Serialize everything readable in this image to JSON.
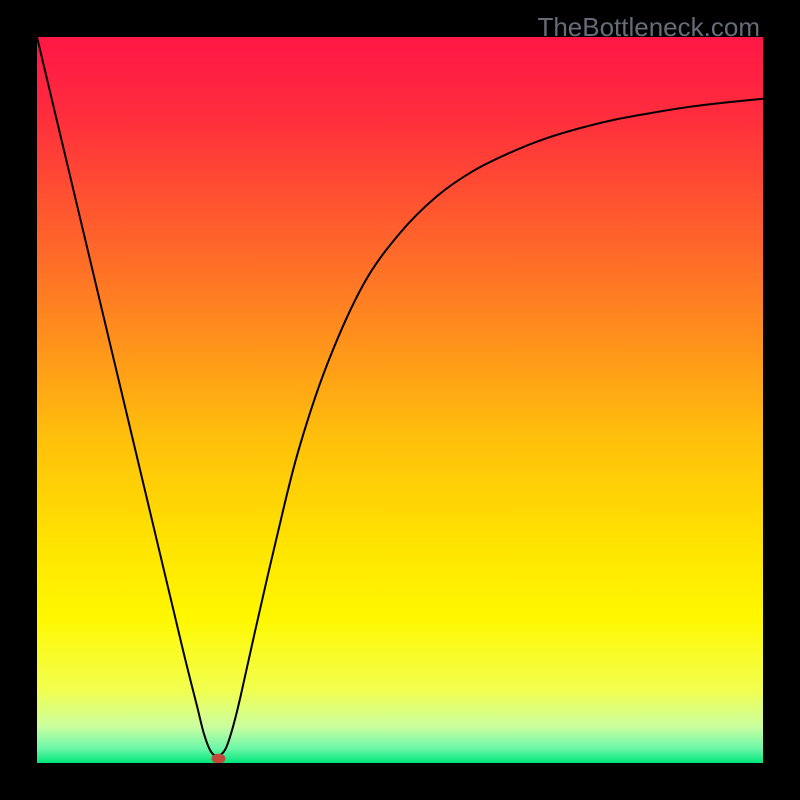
{
  "watermark": "TheBottleneck.com",
  "chart_data": {
    "type": "line",
    "title": "",
    "xlabel": "",
    "ylabel": "",
    "xlim": [
      0,
      100
    ],
    "ylim": [
      0,
      100
    ],
    "grid": false,
    "background": {
      "gradient_stops": [
        {
          "offset": 0.0,
          "color": "#ff1746"
        },
        {
          "offset": 0.1,
          "color": "#ff2b3e"
        },
        {
          "offset": 0.25,
          "color": "#ff5a2e"
        },
        {
          "offset": 0.4,
          "color": "#ff8b1e"
        },
        {
          "offset": 0.55,
          "color": "#ffbf0c"
        },
        {
          "offset": 0.7,
          "color": "#ffe400"
        },
        {
          "offset": 0.8,
          "color": "#fff800"
        },
        {
          "offset": 0.9,
          "color": "#f2ff50"
        },
        {
          "offset": 0.95,
          "color": "#caffa0"
        },
        {
          "offset": 0.98,
          "color": "#6cf7a8"
        },
        {
          "offset": 1.0,
          "color": "#00e67a"
        }
      ]
    },
    "series": [
      {
        "name": "bottleneck-curve",
        "color": "#000000",
        "stroke_width": 2,
        "x": [
          0,
          5,
          10,
          15,
          20,
          22,
          23,
          24,
          25,
          26,
          27,
          28,
          30,
          33,
          36,
          40,
          45,
          50,
          55,
          60,
          65,
          70,
          75,
          80,
          85,
          90,
          95,
          100
        ],
        "values": [
          100,
          79,
          58,
          37,
          16,
          8,
          4,
          1.5,
          1,
          2,
          5,
          9,
          18,
          31,
          43,
          55,
          66,
          73,
          78,
          81.5,
          84,
          86,
          87.5,
          88.7,
          89.6,
          90.4,
          91,
          91.5
        ]
      }
    ],
    "marker": {
      "name": "optimal-point",
      "x": 25,
      "y": 0.6,
      "color": "#c0493a",
      "rx": 7,
      "ry": 5
    }
  }
}
